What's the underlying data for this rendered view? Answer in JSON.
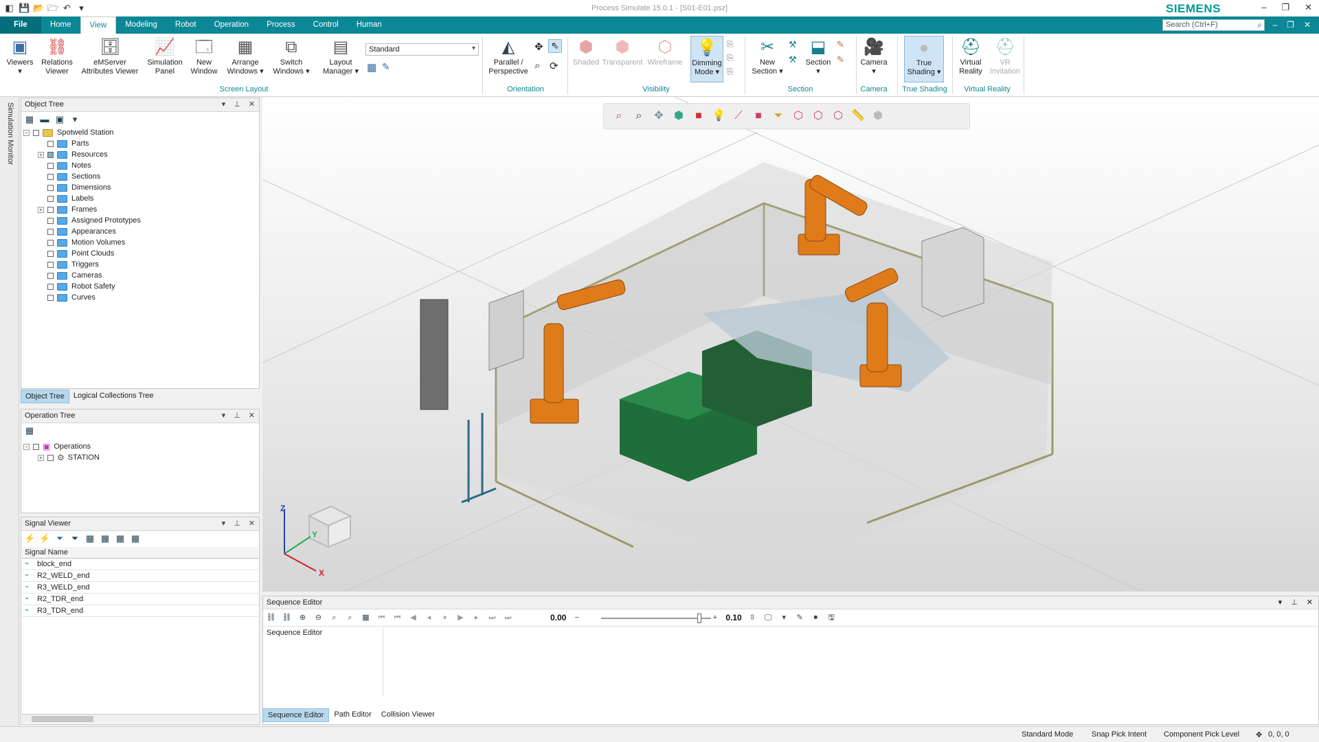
{
  "window": {
    "title": "Process Simulate 15.0.1 - [S01-E01.psz]",
    "brand": "SIEMENS",
    "brand_color": "#009999"
  },
  "quick_access": [
    "app-icon",
    "save-icon",
    "open-icon",
    "open-folder-icon",
    "undo-icon",
    "customize-icon"
  ],
  "tabs": [
    "File",
    "Home",
    "View",
    "Modeling",
    "Robot",
    "Operation",
    "Process",
    "Control",
    "Human"
  ],
  "active_tab": "View",
  "search": {
    "placeholder": "Search (Ctrl+F)"
  },
  "ribbon": {
    "viewers": "Viewers",
    "relations_viewer": "Relations Viewer",
    "emserver_viewer": "eMServer Attributes Viewer",
    "simulation_panel": "Simulation Panel",
    "new_window": "New Window",
    "arrange_windows": "Arrange Windows",
    "switch_windows": "Switch Windows",
    "layout_manager": "Layout Manager",
    "layout_combo": "Standard",
    "group_screen_layout": "Screen Layout",
    "parallel_perspective": "Parallel / Perspective",
    "group_orientation": "Orientation",
    "shaded": "Shaded",
    "transparent": "Transparent",
    "wireframe": "Wireframe",
    "dimming_mode": "Dimming Mode",
    "group_visibility": "Visibility",
    "new_section": "New Section",
    "section": "Section",
    "group_section": "Section",
    "camera": "Camera",
    "group_camera": "Camera",
    "true_shading": "True Shading",
    "group_true_shading": "True Shading",
    "virtual_reality": "Virtual Reality",
    "vr_invitation": "VR Invitation",
    "group_virtual_reality": "Virtual Reality"
  },
  "side_strip": {
    "label": "Simulation Monitor"
  },
  "object_tree": {
    "title": "Object Tree",
    "root": "Spotweld Station",
    "items": [
      "Parts",
      "Resources",
      "Notes",
      "Sections",
      "Dimensions",
      "Labels",
      "Frames",
      "Assigned Prototypes",
      "Appearances",
      "Motion Volumes",
      "Point Clouds",
      "Triggers",
      "Cameras",
      "Robot Safety",
      "Curves"
    ],
    "tab_object_tree": "Object Tree",
    "tab_logical": "Logical Collections Tree"
  },
  "operation_tree": {
    "title": "Operation Tree",
    "root": "Operations",
    "child": "STATION"
  },
  "signal_viewer": {
    "title": "Signal Viewer",
    "column": "Signal Name",
    "signals": [
      "block_end",
      "R2_WELD_end",
      "R3_WELD_end",
      "R2_TDR_end",
      "R3_TDR_end"
    ]
  },
  "viewport": {
    "axis_z": "Z",
    "axis_y": "Y",
    "axis_x": "X"
  },
  "sequence_editor": {
    "title": "Sequence Editor",
    "time": "0.00",
    "step": "0.10",
    "tree_header": "Sequence Editor",
    "tabs": [
      "Sequence Editor",
      "Path Editor",
      "Collision Viewer"
    ]
  },
  "status": {
    "mode": "Standard Mode",
    "snap": "Snap Pick Intent",
    "pick_level": "Component Pick Level",
    "coords": "0, 0, 0"
  }
}
